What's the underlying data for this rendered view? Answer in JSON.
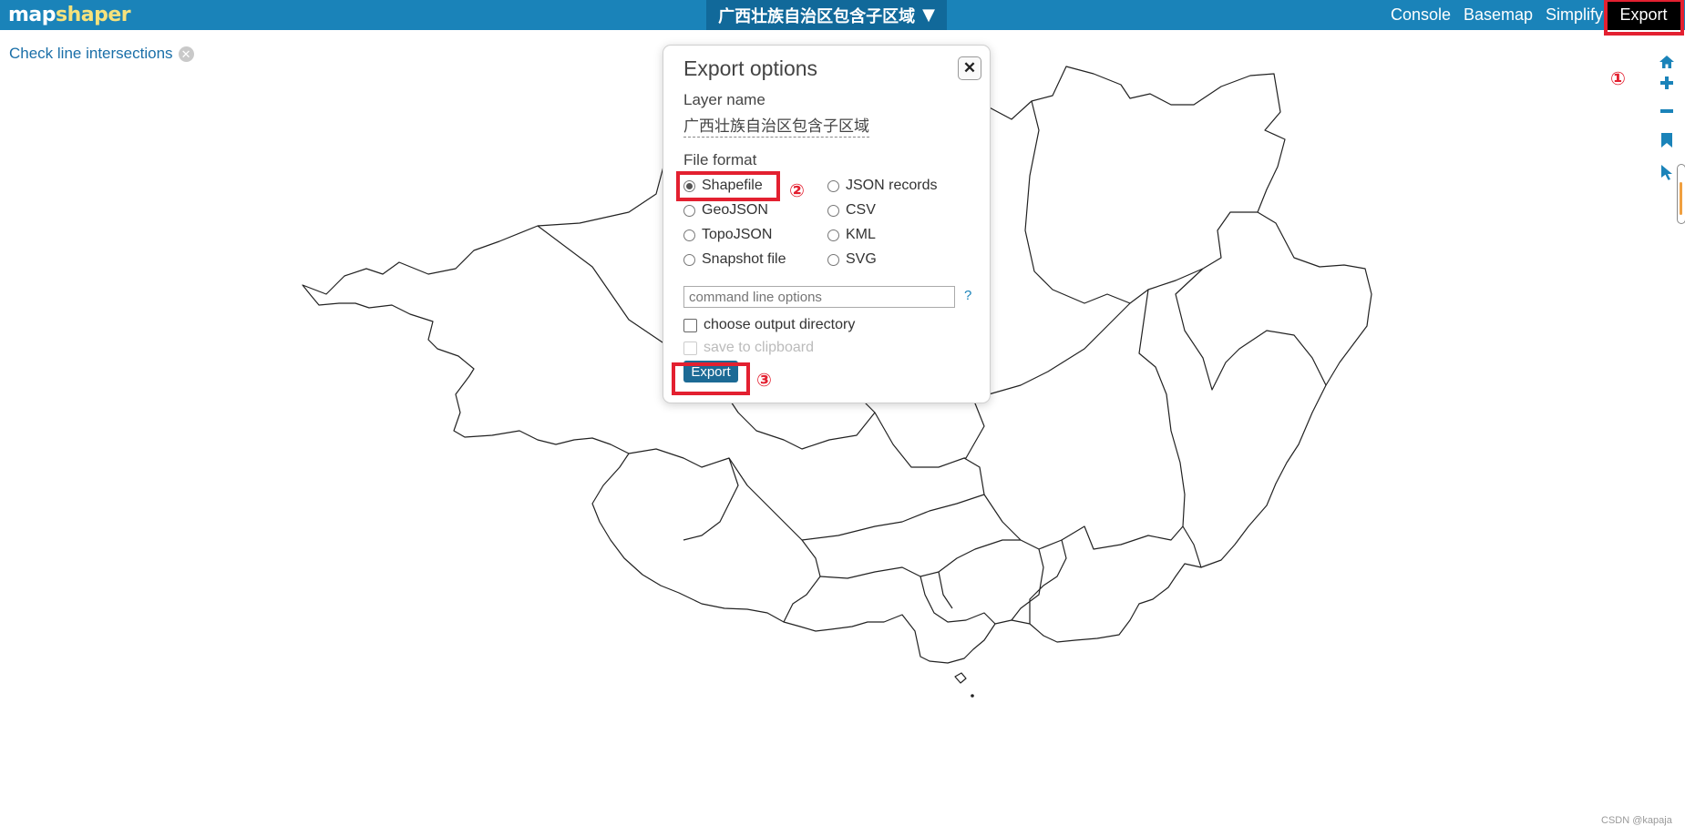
{
  "app": {
    "logo_part1": "map",
    "logo_part2": "shaper"
  },
  "header": {
    "layer_title": "广西壮族自治区包含子区域",
    "layer_caret": "▼",
    "nav": {
      "console": "Console",
      "basemap": "Basemap",
      "simplify": "Simplify",
      "export": "Export"
    }
  },
  "intersections": {
    "label": "Check line intersections",
    "close_glyph": "✕"
  },
  "dialog": {
    "title": "Export options",
    "close_glyph": "✕",
    "layer_name_label": "Layer name",
    "layer_name_value": "广西壮族自治区包含子区域",
    "file_format_label": "File format",
    "formats_left": [
      "Shapefile",
      "GeoJSON",
      "TopoJSON",
      "Snapshot file"
    ],
    "formats_right": [
      "JSON records",
      "CSV",
      "KML",
      "SVG"
    ],
    "selected_format": "Shapefile",
    "cmd_placeholder": "command line options",
    "help": "?",
    "choose_dir_label": "choose output directory",
    "clipboard_label": "save to clipboard",
    "export_button": "Export"
  },
  "annotations": {
    "m1": "①",
    "m2": "②",
    "m3": "③"
  },
  "tools": [
    "home-icon",
    "zoom-in-icon",
    "zoom-out-icon",
    "bookmark-icon",
    "pointer-icon"
  ],
  "watermark": "CSDN @kapaja",
  "colors": {
    "topbar": "#1a83b9",
    "layer_btn": "#11699a",
    "logo_accent": "#f6e27c",
    "annotation_red": "#e32030"
  }
}
